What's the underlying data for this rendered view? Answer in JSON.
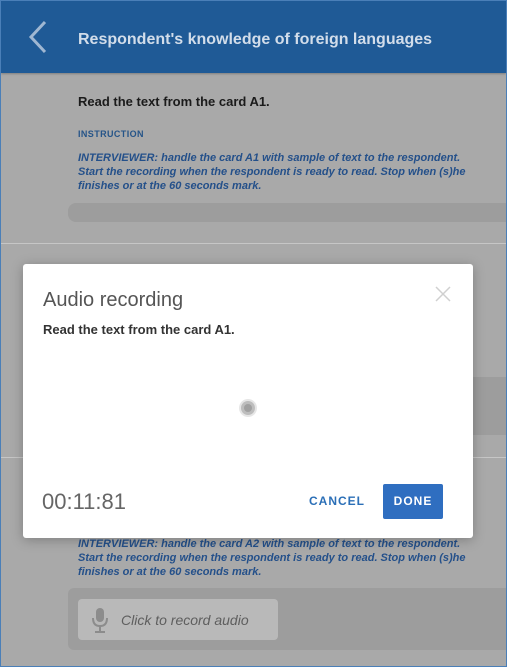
{
  "header": {
    "title": "Respondent's knowledge of foreign languages"
  },
  "question1": {
    "text": "Read the text from the card A1.",
    "instruction_label": "INSTRUCTION",
    "instruction": "INTERVIEWER: handle the card A1 with sample of text to the respondent. Start the recording when the respondent is ready to read. Stop when (s)he finishes or at the 60 seconds mark."
  },
  "question2": {
    "instruction": "INTERVIEWER: handle the card A2 with sample of text to the respondent. Start the recording when the respondent is ready to read. Stop when (s)he finishes or at the 60 seconds mark.",
    "record_label": "Click to record audio"
  },
  "modal": {
    "title": "Audio recording",
    "text": "Read the text from the card A1.",
    "timer": "00:11:81",
    "cancel_label": "CANCEL",
    "done_label": "DONE"
  },
  "icons": {
    "back": "chevron-left-icon",
    "close": "close-icon",
    "mic": "microphone-icon",
    "recording": "recording-indicator-icon"
  },
  "colors": {
    "header": "#1f5a96",
    "accent": "#2f6ec0",
    "overlay": "#a9a9a9"
  }
}
